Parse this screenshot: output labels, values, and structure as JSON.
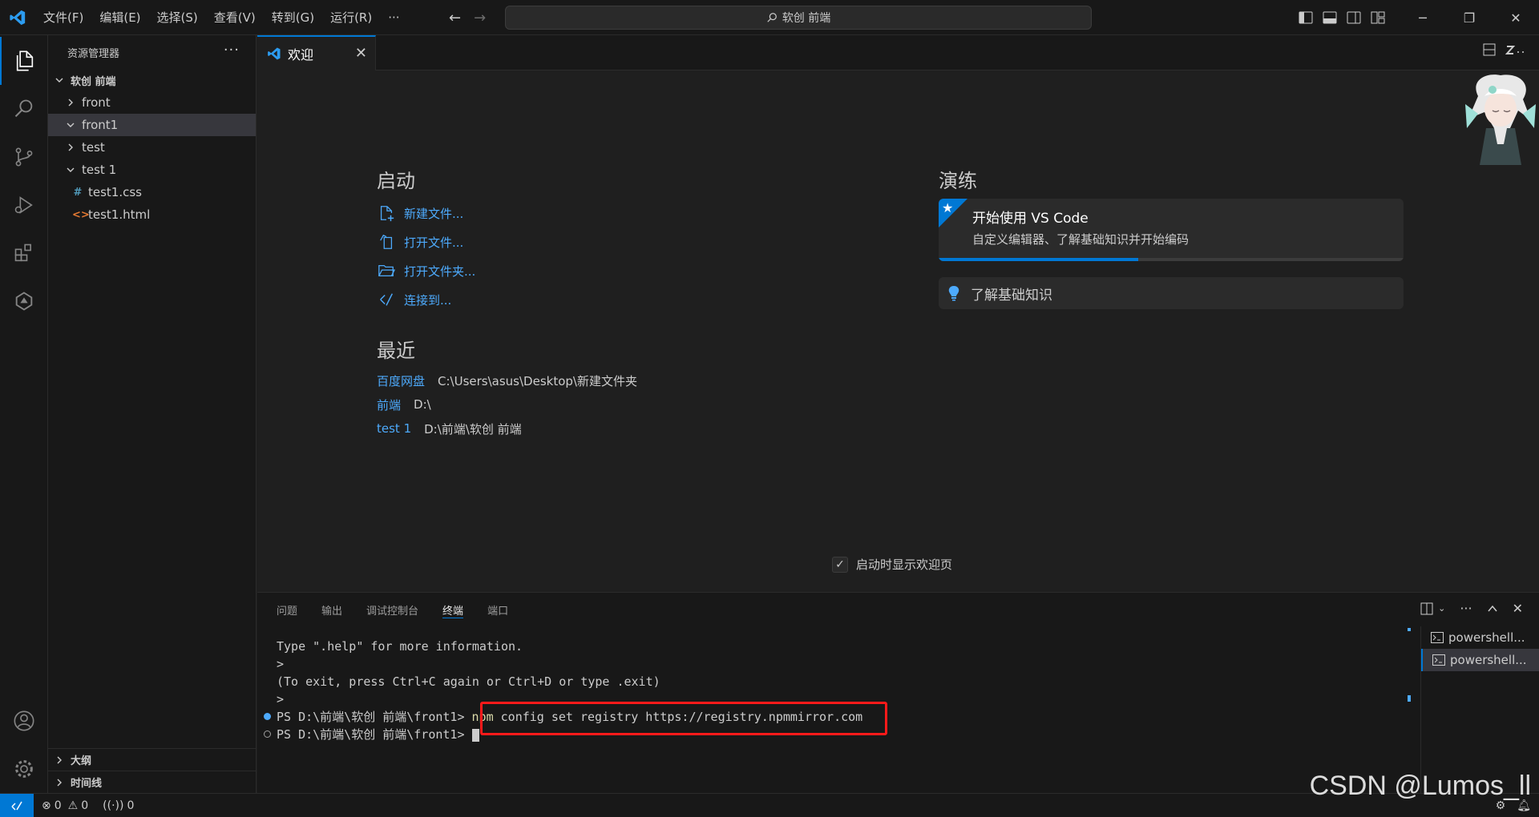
{
  "titlebar": {
    "menus": [
      "文件(F)",
      "编辑(E)",
      "选择(S)",
      "查看(V)",
      "转到(G)",
      "运行(R)",
      "···"
    ],
    "search_text": "软创 前端"
  },
  "sidebar": {
    "title": "资源管理器",
    "more": "···",
    "root": "软创 前端",
    "items": [
      {
        "label": "front",
        "type": "folder",
        "expanded": false
      },
      {
        "label": "front1",
        "type": "folder",
        "expanded": true
      },
      {
        "label": "test",
        "type": "folder",
        "expanded": false
      },
      {
        "label": "test 1",
        "type": "folder",
        "expanded": true
      },
      {
        "label": "test1.css",
        "type": "file",
        "icon": "#"
      },
      {
        "label": "test1.html",
        "type": "file",
        "icon": "<>"
      }
    ],
    "sections": [
      "大纲",
      "时间线"
    ]
  },
  "editor": {
    "tab_label": "欢迎",
    "welcome": {
      "start_title": "启动",
      "start_links": [
        "新建文件...",
        "打开文件...",
        "打开文件夹...",
        "连接到..."
      ],
      "recent_title": "最近",
      "recent": [
        {
          "name": "百度网盘",
          "path": "C:\\Users\\asus\\Desktop\\新建文件夹"
        },
        {
          "name": "前端",
          "path": "D:\\"
        },
        {
          "name": "test 1",
          "path": "D:\\前端\\软创 前端"
        }
      ],
      "walk_title": "演练",
      "walk_card_title": "开始使用 VS Code",
      "walk_card_desc": "自定义编辑器、了解基础知识并开始编码",
      "walk_progress": 0.43,
      "walk_card2": "了解基础知识",
      "show_on_startup": "启动时显示欢迎页"
    }
  },
  "panel": {
    "tabs": [
      "问题",
      "输出",
      "调试控制台",
      "终端",
      "端口"
    ],
    "active_tab": "终端",
    "terminal_lines": [
      "Type \".help\" for more information.",
      ">",
      "(To exit, press Ctrl+C again or Ctrl+D or type .exit)",
      ">"
    ],
    "prompt": "PS D:\\前端\\软创 前端\\front1> ",
    "command_npm": "npm",
    "command_rest": " config set registry https://registry.npmmirror.com",
    "prompt2": "PS D:\\前端\\软创 前端\\front1> ",
    "terminals": [
      "powershell...",
      "powershell..."
    ]
  },
  "statusbar": {
    "errors": "0",
    "warnings": "0",
    "ports": "0"
  },
  "watermark": "CSDN @Lumos_ll",
  "colors": {
    "accent": "#0078d4",
    "link": "#4daafc",
    "highlight_box": "#ff1a1a"
  }
}
